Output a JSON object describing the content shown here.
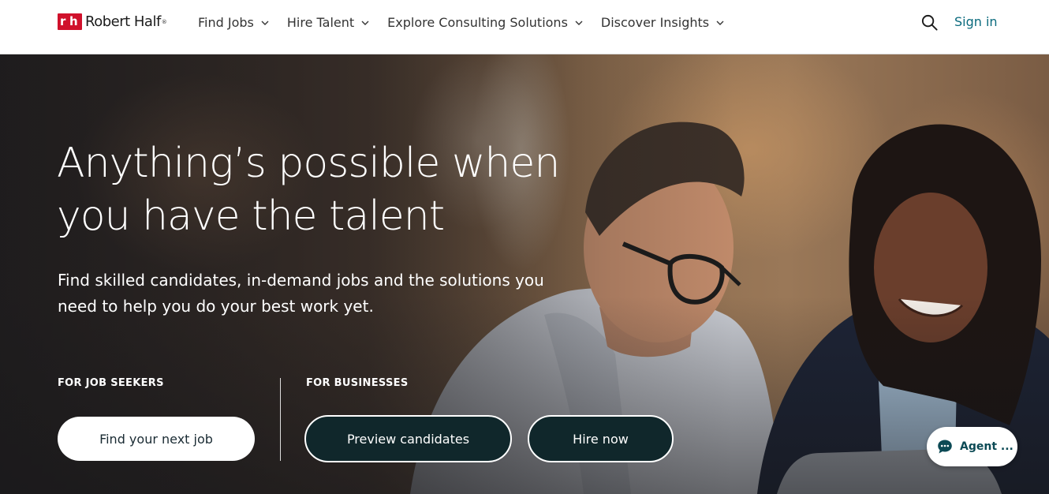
{
  "brand": {
    "name": "Robert Half",
    "mark": "rh",
    "trademark": "®",
    "color": "#d0112b"
  },
  "nav": {
    "items": [
      {
        "label": "Find Jobs"
      },
      {
        "label": "Hire Talent"
      },
      {
        "label": "Explore Consulting Solutions"
      },
      {
        "label": "Discover Insights"
      }
    ],
    "sign_in": "Sign in"
  },
  "hero": {
    "title": "Anything’s possible when you have the talent",
    "subtitle": "Find skilled candidates, in-demand jobs and the solutions you need to help you do your best work yet.",
    "job_seekers": {
      "label": "FOR JOB SEEKERS",
      "button": "Find your next job"
    },
    "businesses": {
      "label": "FOR BUSINESSES",
      "button_preview": "Preview candidates",
      "button_hire": "Hire now"
    }
  },
  "chat": {
    "label": "Agent ..."
  },
  "colors": {
    "accent": "#0a6a7d",
    "button_dark": "#10272b"
  }
}
